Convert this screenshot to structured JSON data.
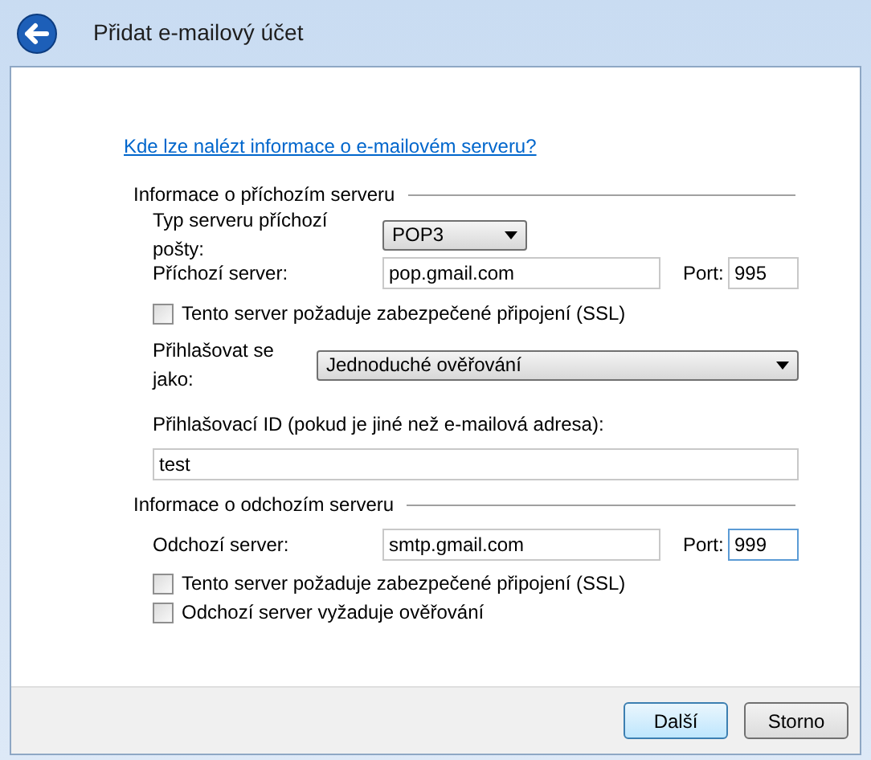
{
  "window": {
    "title": "Přidat e-mailový účet"
  },
  "help_link": "Kde lze nalézt informace o e-mailovém serveru?",
  "incoming": {
    "heading": "Informace o příchozím serveru",
    "type_label": "Typ serveru příchozí pošty:",
    "type_value": "POP3",
    "server_label": "Příchozí server:",
    "server_value": "pop.gmail.com",
    "port_label": "Port:",
    "port_value": "995",
    "ssl": {
      "label": "Tento server požaduje zabezpečené připojení (SSL)",
      "checked": false
    },
    "login_label": "Přihlašovat se jako:",
    "login_value": "Jednoduché ověřování",
    "id_label": "Přihlašovací ID (pokud je jiné než e-mailová adresa):",
    "id_value": "test"
  },
  "outgoing": {
    "heading": "Informace o odchozím serveru",
    "server_label": "Odchozí server:",
    "server_value": "smtp.gmail.com",
    "port_label": "Port:",
    "port_value": "999",
    "port_focused": true,
    "checkboxes": [
      {
        "label": "Tento server požaduje zabezpečené připojení (SSL)",
        "checked": false
      },
      {
        "label": "Odchozí server vyžaduje ověřování",
        "checked": false
      }
    ]
  },
  "buttons": [
    {
      "label": "Další",
      "default": true
    },
    {
      "label": "Storno",
      "default": false
    }
  ]
}
